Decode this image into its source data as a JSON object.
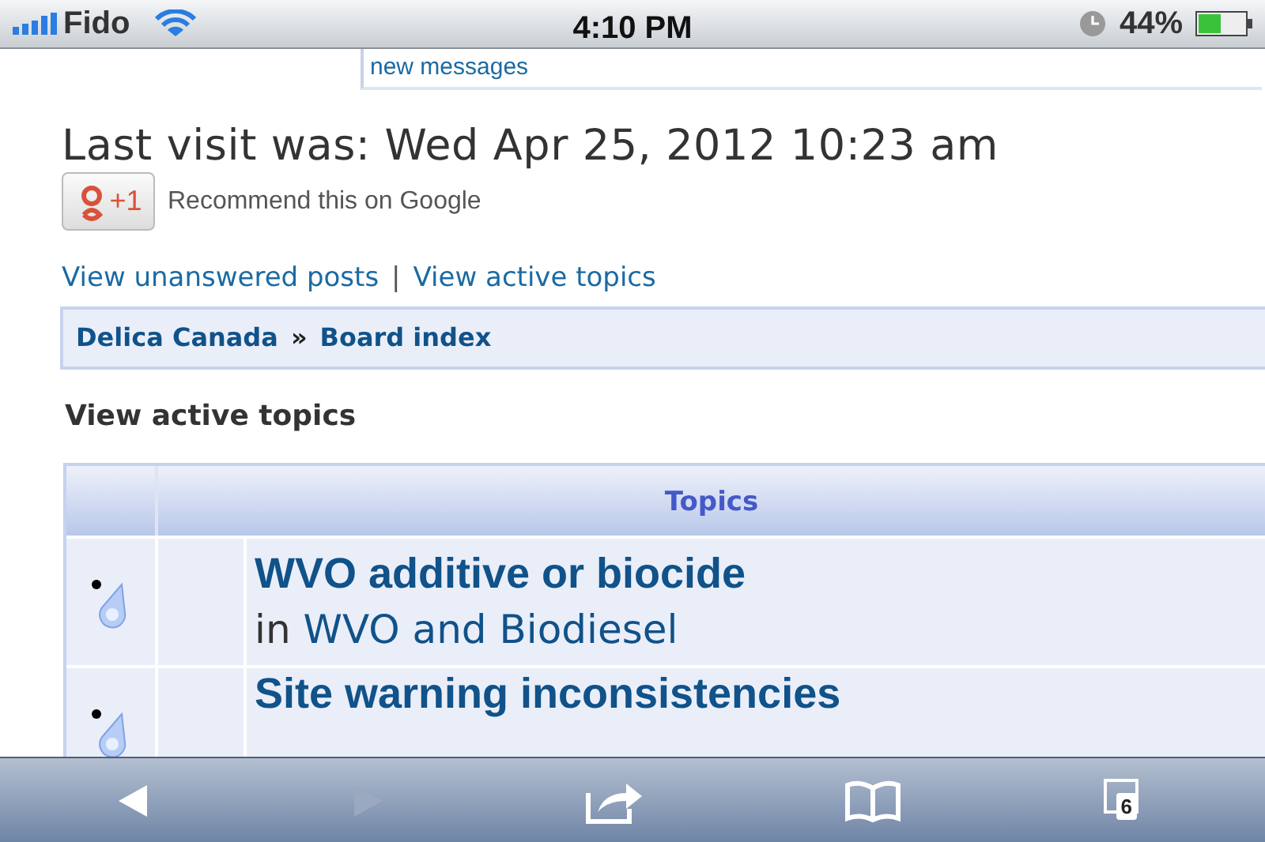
{
  "status_bar": {
    "carrier": "Fido",
    "time": "4:10 PM",
    "battery": "44%"
  },
  "notice": {
    "text": "new messages"
  },
  "last_visit": "Last visit was: Wed Apr 25, 2012 10:23 am",
  "plus_one": {
    "label": "+1",
    "text": "Recommend this on Google"
  },
  "quick_links": [
    {
      "label": "View unanswered posts"
    },
    {
      "label": "View active topics"
    }
  ],
  "quick_links_separator": "|",
  "breadcrumb": [
    {
      "label": "Delica Canada"
    },
    {
      "label": "Board index"
    }
  ],
  "breadcrumb_separator": "»",
  "section_title": "View active topics",
  "table": {
    "columns": [
      "Topics"
    ],
    "rows": [
      {
        "title": "WVO additive or biocide",
        "prefix": "in",
        "forum": "WVO and Biodiesel"
      },
      {
        "title": "Site warning inconsistencies"
      }
    ]
  },
  "toolbar": {
    "back": {
      "disabled": false
    },
    "forward": {
      "disabled": true
    },
    "tabs_count": "6"
  }
}
